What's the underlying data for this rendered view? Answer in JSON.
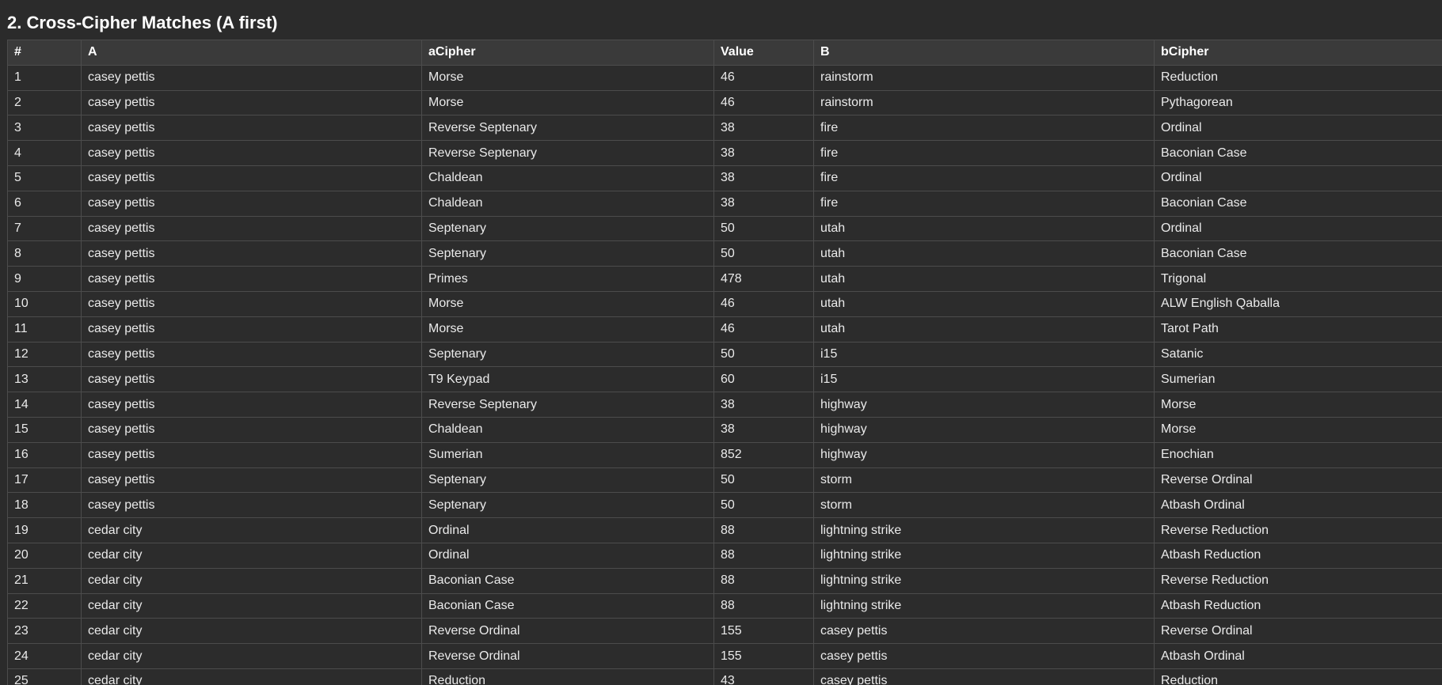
{
  "title": "2. Cross-Cipher Matches (A first)",
  "table": {
    "headers": [
      "#",
      "A",
      "aCipher",
      "Value",
      "B",
      "bCipher"
    ],
    "rows": [
      [
        "1",
        "casey pettis",
        "Morse",
        "46",
        "rainstorm",
        "Reduction"
      ],
      [
        "2",
        "casey pettis",
        "Morse",
        "46",
        "rainstorm",
        "Pythagorean"
      ],
      [
        "3",
        "casey pettis",
        "Reverse Septenary",
        "38",
        "fire",
        "Ordinal"
      ],
      [
        "4",
        "casey pettis",
        "Reverse Septenary",
        "38",
        "fire",
        "Baconian Case"
      ],
      [
        "5",
        "casey pettis",
        "Chaldean",
        "38",
        "fire",
        "Ordinal"
      ],
      [
        "6",
        "casey pettis",
        "Chaldean",
        "38",
        "fire",
        "Baconian Case"
      ],
      [
        "7",
        "casey pettis",
        "Septenary",
        "50",
        "utah",
        "Ordinal"
      ],
      [
        "8",
        "casey pettis",
        "Septenary",
        "50",
        "utah",
        "Baconian Case"
      ],
      [
        "9",
        "casey pettis",
        "Primes",
        "478",
        "utah",
        "Trigonal"
      ],
      [
        "10",
        "casey pettis",
        "Morse",
        "46",
        "utah",
        "ALW English Qaballa"
      ],
      [
        "11",
        "casey pettis",
        "Morse",
        "46",
        "utah",
        "Tarot Path"
      ],
      [
        "12",
        "casey pettis",
        "Septenary",
        "50",
        "i15",
        "Satanic"
      ],
      [
        "13",
        "casey pettis",
        "T9 Keypad",
        "60",
        "i15",
        "Sumerian"
      ],
      [
        "14",
        "casey pettis",
        "Reverse Septenary",
        "38",
        "highway",
        "Morse"
      ],
      [
        "15",
        "casey pettis",
        "Chaldean",
        "38",
        "highway",
        "Morse"
      ],
      [
        "16",
        "casey pettis",
        "Sumerian",
        "852",
        "highway",
        "Enochian"
      ],
      [
        "17",
        "casey pettis",
        "Septenary",
        "50",
        "storm",
        "Reverse Ordinal"
      ],
      [
        "18",
        "casey pettis",
        "Septenary",
        "50",
        "storm",
        "Atbash Ordinal"
      ],
      [
        "19",
        "cedar city",
        "Ordinal",
        "88",
        "lightning strike",
        "Reverse Reduction"
      ],
      [
        "20",
        "cedar city",
        "Ordinal",
        "88",
        "lightning strike",
        "Atbash Reduction"
      ],
      [
        "21",
        "cedar city",
        "Baconian Case",
        "88",
        "lightning strike",
        "Reverse Reduction"
      ],
      [
        "22",
        "cedar city",
        "Baconian Case",
        "88",
        "lightning strike",
        "Atbash Reduction"
      ],
      [
        "23",
        "cedar city",
        "Reverse Ordinal",
        "155",
        "casey pettis",
        "Reverse Ordinal"
      ],
      [
        "24",
        "cedar city",
        "Reverse Ordinal",
        "155",
        "casey pettis",
        "Atbash Ordinal"
      ],
      [
        "25",
        "cedar city",
        "Reduction",
        "43",
        "casey pettis",
        "Reduction"
      ]
    ]
  }
}
